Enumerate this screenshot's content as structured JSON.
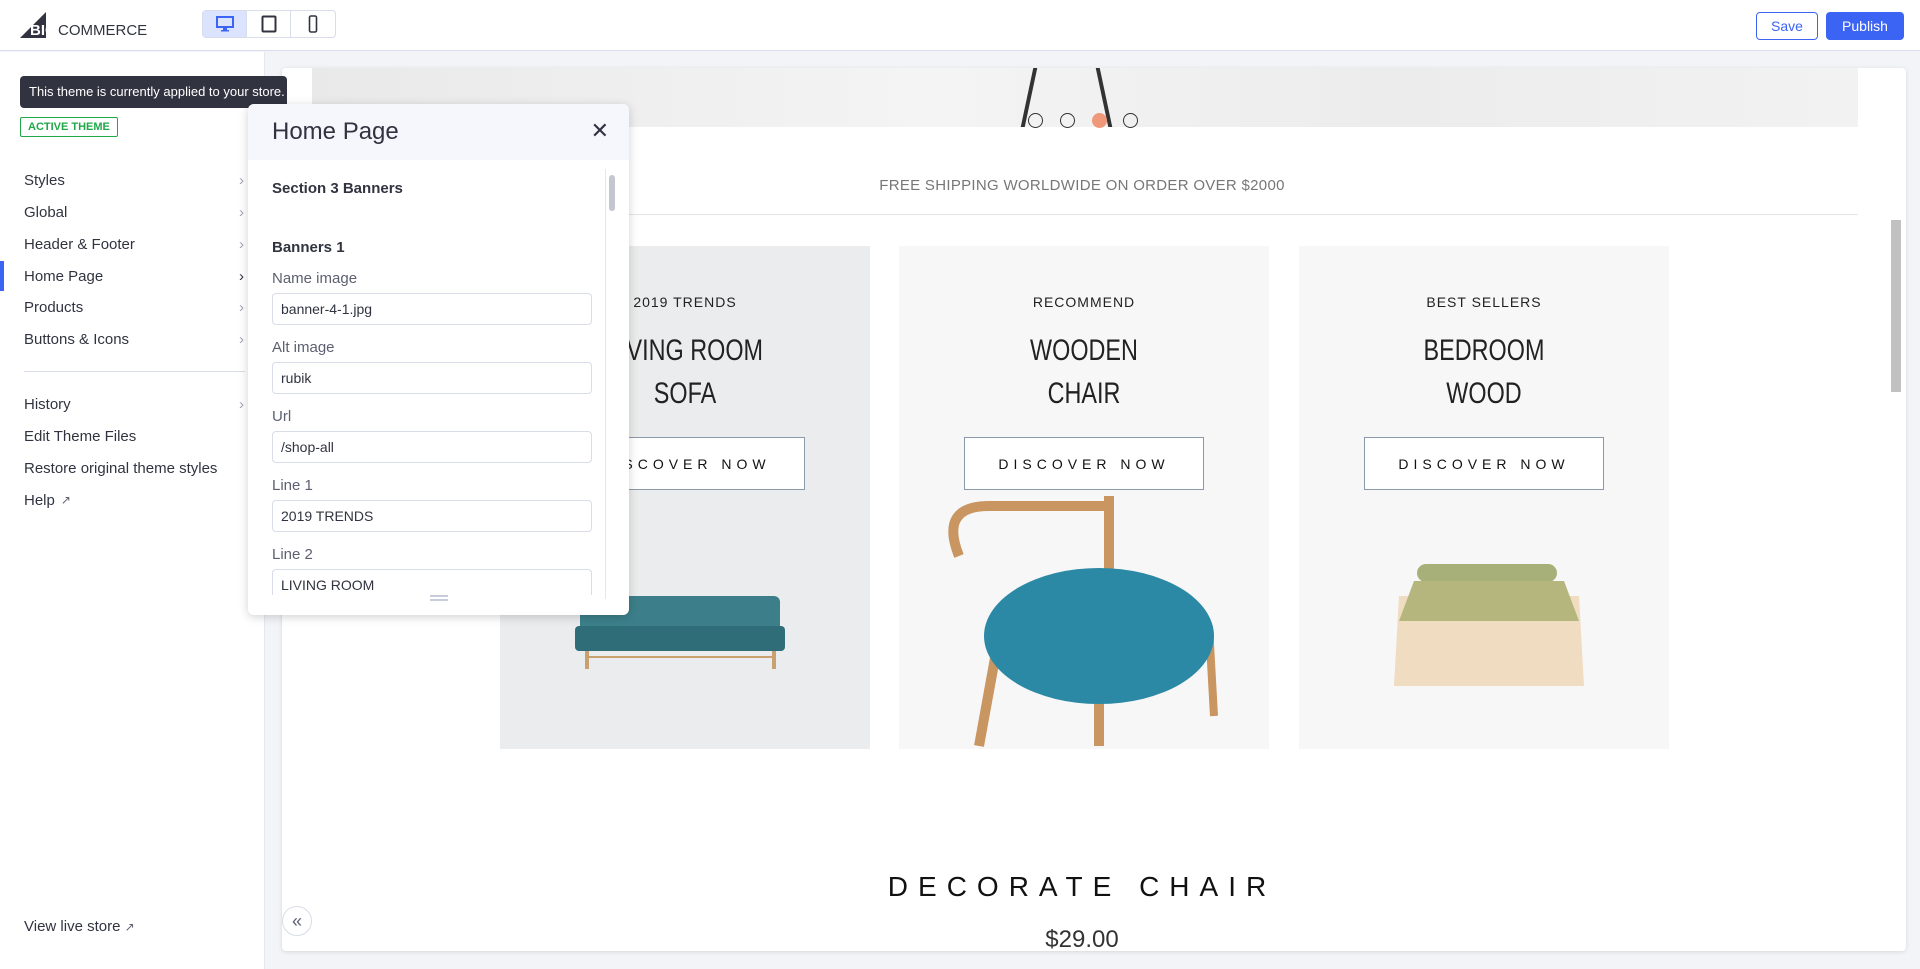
{
  "header": {
    "logo_text": "BIGCOMMERCE",
    "devices": [
      {
        "icon": "desktop-icon",
        "active": true
      },
      {
        "icon": "tablet-icon",
        "active": false
      },
      {
        "icon": "mobile-icon",
        "active": false
      }
    ],
    "save_label": "Save",
    "publish_label": "Publish"
  },
  "sidebar": {
    "tooltip": "This theme is currently applied to your store.",
    "badge": "ACTIVE THEME",
    "items": [
      {
        "label": "Styles"
      },
      {
        "label": "Global"
      },
      {
        "label": "Header & Footer"
      },
      {
        "label": "Home Page",
        "active": true
      },
      {
        "label": "Products"
      },
      {
        "label": "Buttons & Icons"
      }
    ],
    "items2": [
      {
        "label": "History",
        "chevron": true
      },
      {
        "label": "Edit Theme Files"
      },
      {
        "label": "Restore original theme styles"
      },
      {
        "label": "Help",
        "external": true
      }
    ],
    "view_live": "View live store"
  },
  "panel": {
    "title": "Home Page",
    "section": "Section 3 Banners",
    "subsection": "Banners 1",
    "fields": [
      {
        "label": "Name image",
        "value": "banner-4-1.jpg"
      },
      {
        "label": "Alt image",
        "value": "rubik"
      },
      {
        "label": "Url",
        "value": "/shop-all"
      },
      {
        "label": "Line 1",
        "value": "2019 TRENDS"
      },
      {
        "label": "Line 2",
        "value": "LIVING ROOM"
      }
    ]
  },
  "preview": {
    "slider_dots": 4,
    "active_dot": 3,
    "shipping": "FREE SHIPPING WORLDWIDE ON ORDER OVER $2000",
    "banners": [
      {
        "line1": "2019 TRENDS",
        "line2": "LIVING ROOM",
        "line3": "SOFA",
        "button": "DISCOVER NOW"
      },
      {
        "line1": "RECOMMEND",
        "line2": "WOODEN",
        "line3": "CHAIR",
        "button": "DISCOVER NOW"
      },
      {
        "line1": "BEST SELLERS",
        "line2": "BEDROOM",
        "line3": "WOOD",
        "button": "DISCOVER NOW"
      }
    ],
    "product_title": "DECORATE CHAIR",
    "product_price": "$29.00"
  },
  "colors": {
    "accent": "#3c64f4",
    "active_badge": "#20a848",
    "dot_active": "#f0987a"
  }
}
